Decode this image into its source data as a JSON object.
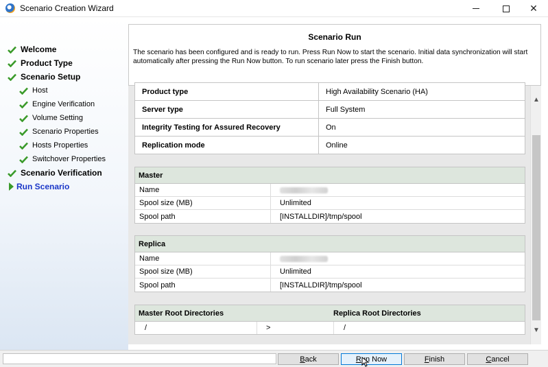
{
  "window": {
    "title": "Scenario Creation Wizard"
  },
  "sidebar": {
    "items": [
      {
        "label": "Welcome",
        "state": "done",
        "level": "top"
      },
      {
        "label": "Product Type",
        "state": "done",
        "level": "top"
      },
      {
        "label": "Scenario Setup",
        "state": "done",
        "level": "top"
      },
      {
        "label": "Host",
        "state": "done",
        "level": "sub"
      },
      {
        "label": "Engine Verification",
        "state": "done",
        "level": "sub"
      },
      {
        "label": "Volume Setting",
        "state": "done",
        "level": "sub"
      },
      {
        "label": "Scenario Properties",
        "state": "done",
        "level": "sub"
      },
      {
        "label": "Hosts Properties",
        "state": "done",
        "level": "sub"
      },
      {
        "label": "Switchover Properties",
        "state": "done",
        "level": "sub"
      },
      {
        "label": "Scenario Verification",
        "state": "done",
        "level": "top"
      },
      {
        "label": "Run Scenario",
        "state": "current",
        "level": "top"
      }
    ]
  },
  "header": {
    "title": "Scenario Run",
    "description": "The scenario has been configured and is ready to run. Press Run Now to start the scenario. Initial data synchronization will start automatically after pressing the Run Now button. To run scenario later press the Finish button."
  },
  "summary": [
    {
      "key": "Product type",
      "value": "High Availability Scenario (HA)"
    },
    {
      "key": "Server type",
      "value": "Full System"
    },
    {
      "key": "Integrity Testing for Assured Recovery",
      "value": "On"
    },
    {
      "key": "Replication mode",
      "value": "Online"
    }
  ],
  "master": {
    "heading": "Master",
    "rows": [
      {
        "key": "Name",
        "value": ""
      },
      {
        "key": "Spool size (MB)",
        "value": "Unlimited"
      },
      {
        "key": "Spool path",
        "value": "[INSTALLDIR]/tmp/spool"
      }
    ]
  },
  "replica": {
    "heading": "Replica",
    "rows": [
      {
        "key": "Name",
        "value": ""
      },
      {
        "key": "Spool size (MB)",
        "value": "Unlimited"
      },
      {
        "key": "Spool path",
        "value": "[INSTALLDIR]/tmp/spool"
      }
    ]
  },
  "directories": {
    "master_heading": "Master Root Directories",
    "replica_heading": "Replica Root Directories",
    "rows": [
      {
        "master": "/",
        "arrow": ">",
        "replica": "/"
      }
    ]
  },
  "buttons": {
    "back_prefix": "B",
    "back_rest": "ack",
    "run_prefix": "R",
    "run_rest": "un Now",
    "finish_prefix": "F",
    "finish_rest": "inish",
    "cancel_prefix": "C",
    "cancel_rest": "ancel"
  },
  "colors": {
    "check": "#3a9a2a",
    "current": "#1a37c8",
    "group_header": "#dde6dd"
  }
}
